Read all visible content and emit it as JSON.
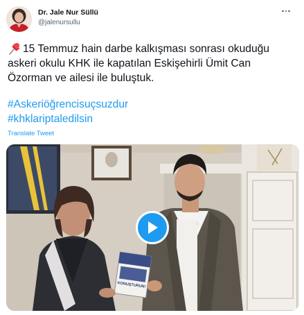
{
  "author": {
    "display_name": "Dr. Jale Nur Süllü",
    "handle": "@jalenursullu",
    "avatar_icon": "profile-photo",
    "more_icon": "more-dots-icon"
  },
  "tweet": {
    "pin_icon": "pushpin-icon",
    "line1": "15 Temmuz hain darbe kalkışması sonrası okuduğu",
    "line2": "askeri okulu KHK ile kapatılan Eskişehirli Ümit Can",
    "line3": "Özorman ve ailesi ile buluştuk.",
    "hashtags": [
      "#Askeriöğrencisuçsuzdur",
      "#khklariptaledilsin"
    ],
    "translate_label": "Translate Tweet"
  },
  "media": {
    "type": "video",
    "play_icon": "play-icon",
    "book_cover_text": "KONUŞTURUN!"
  },
  "colors": {
    "link": "#1d9bf0",
    "text": "#0f1419",
    "secondary": "#536471"
  }
}
